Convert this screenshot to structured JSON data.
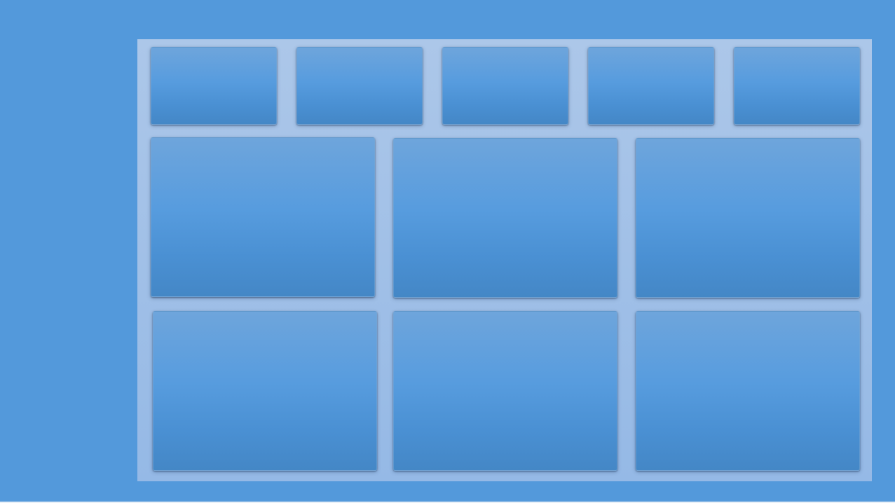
{
  "colors": {
    "background": "#5399db",
    "panel": "#a1c0e7",
    "tile": "#579cde"
  },
  "tile_grid": {
    "rows": [
      {
        "tile_count": 5
      },
      {
        "tile_count": 3
      },
      {
        "tile_count": 3
      }
    ]
  }
}
